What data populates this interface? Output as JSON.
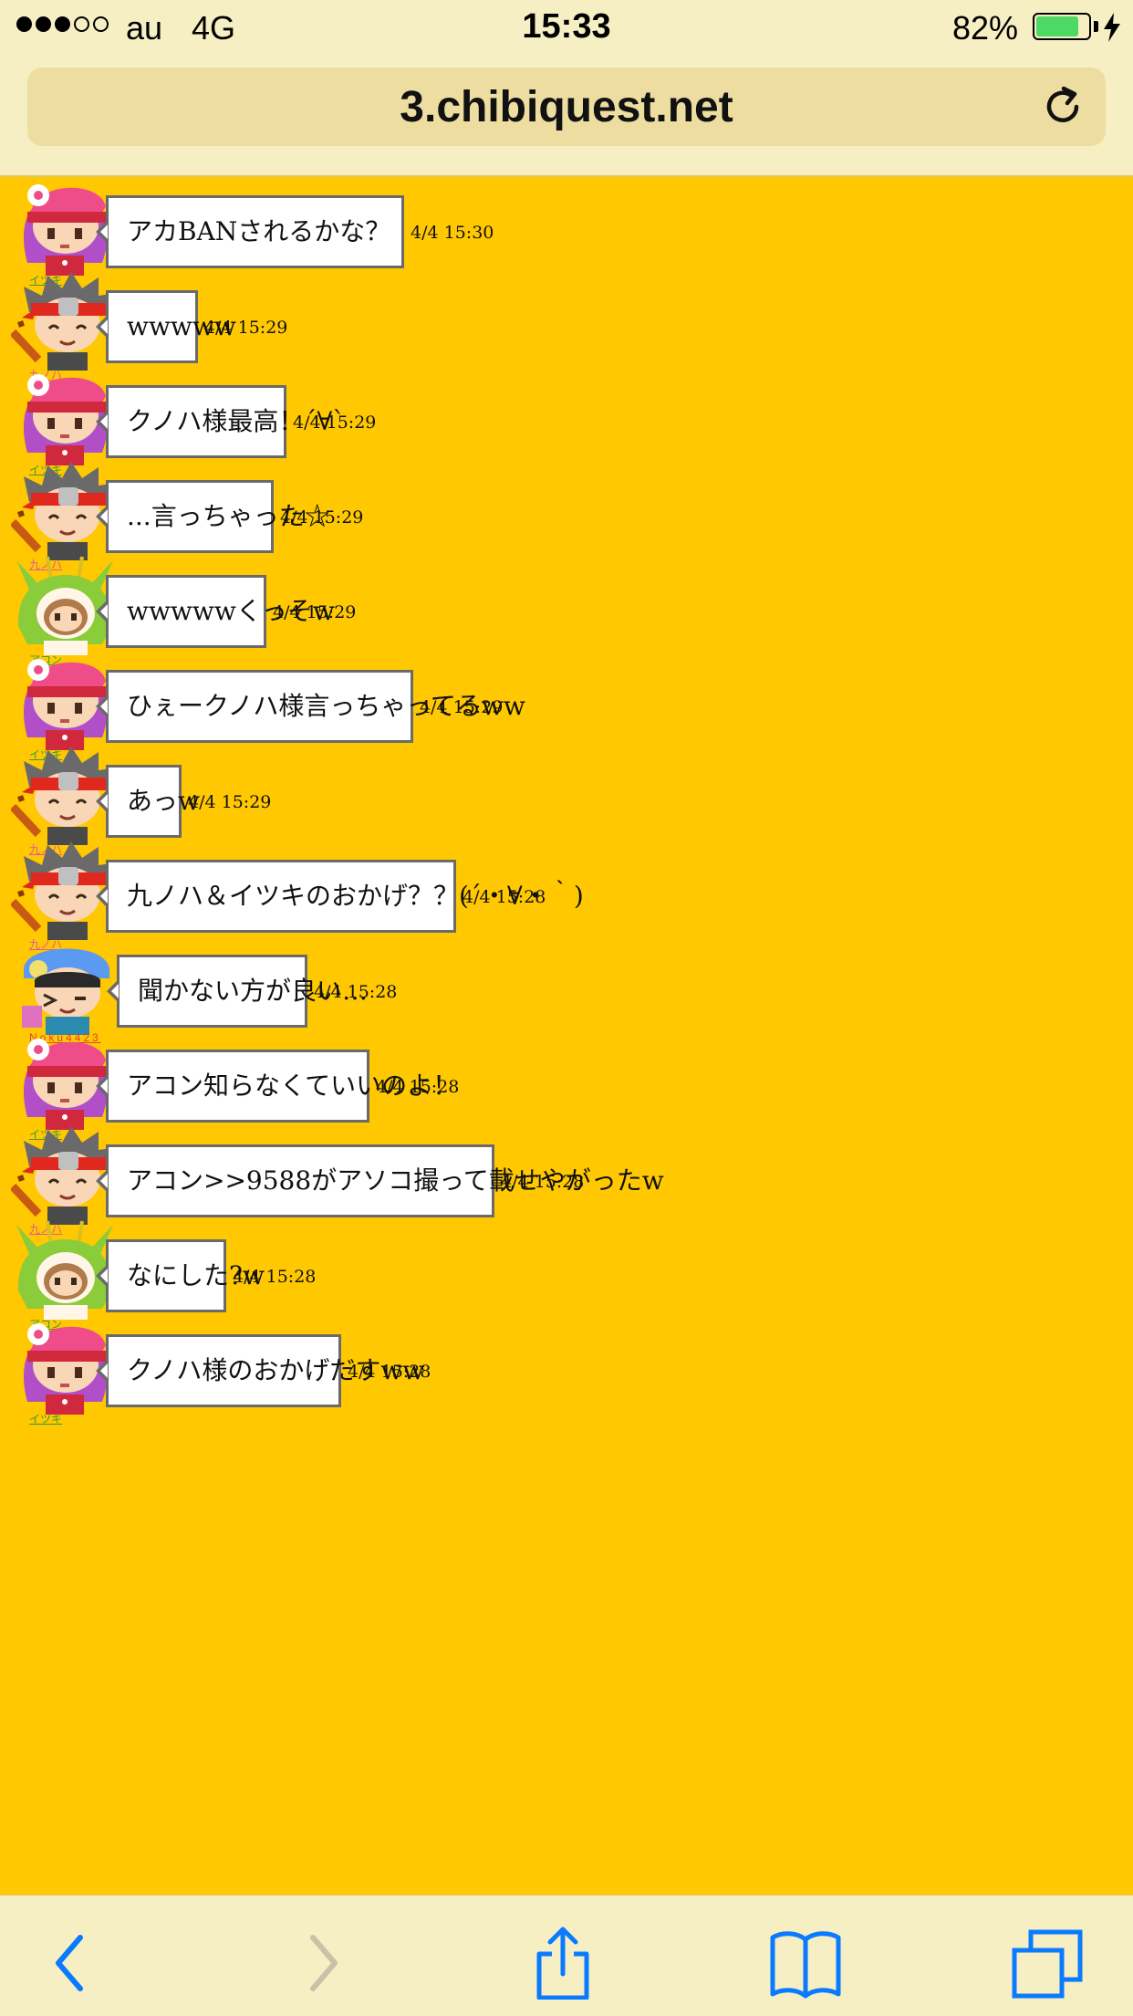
{
  "status_bar": {
    "carrier": "au",
    "network": "4G",
    "time": "15:33",
    "battery_percent": "82%",
    "signal_strength": 3,
    "battery_level": 0.82
  },
  "browser": {
    "url": "3.chibiquest.net"
  },
  "colors": {
    "page_background": "#FFC800",
    "browser_chrome": "#F7EFC4",
    "ios_blue": "#0A7AFF",
    "battery_green": "#4CD964"
  },
  "messages": [
    {
      "user": "イツキ",
      "avatar": "pink-hat-girl-avatar",
      "text": "アカBANされるかな？",
      "time": "4/4 15:30"
    },
    {
      "user": "九ノハ",
      "avatar": "red-headband-ninja-avatar",
      "text": "wwwww",
      "time": "4/4 15:29"
    },
    {
      "user": "イツキ",
      "avatar": "pink-hat-girl-avatar",
      "text": "クノハ様最高！´∀`",
      "time": "4/4 15:29"
    },
    {
      "user": "九ノハ",
      "avatar": "red-headband-ninja-avatar",
      "text": "...言っちゃった☆",
      "time": "4/4 15:29"
    },
    {
      "user": "アコン",
      "avatar": "green-dragon-hood-avatar",
      "text": "wwwwwくっそw",
      "time": "4/4 15:29"
    },
    {
      "user": "イツキ",
      "avatar": "pink-hat-girl-avatar",
      "text": "ひぇークノハ様言っちゃってるww",
      "time": "4/4 15:29"
    },
    {
      "user": "九ノハ",
      "avatar": "red-headband-ninja-avatar",
      "text": "あっw",
      "time": "4/4 15:29"
    },
    {
      "user": "九ノハ",
      "avatar": "red-headband-ninja-avatar",
      "text": "九ノハ＆イツキのおかげ？？(´・∀・｀)",
      "time": "4/4 15:28"
    },
    {
      "user": "Noku4423",
      "avatar": "blue-cap-boy-avatar",
      "text": "聞かない方が良い…",
      "time": "4/4 15:28"
    },
    {
      "user": "イツキ",
      "avatar": "pink-hat-girl-avatar",
      "text": "アコン知らなくていいのよ！",
      "time": "4/4 15:28"
    },
    {
      "user": "九ノハ",
      "avatar": "red-headband-ninja-avatar",
      "text": "アコン>>9588がアソコ撮って載せやがったw",
      "time": "4/4 15:28"
    },
    {
      "user": "アコン",
      "avatar": "green-dragon-hood-avatar",
      "text": "なにした?w",
      "time": "4/4 15:28"
    },
    {
      "user": "イツキ",
      "avatar": "pink-hat-girl-avatar",
      "text": "クノハ様のおかげだすww",
      "time": "4/4 15:28"
    }
  ],
  "toolbar": {
    "back": "back-chevron-icon",
    "forward": "forward-chevron-icon",
    "share": "share-icon",
    "bookmarks": "bookmarks-book-icon",
    "tabs": "tabs-icon"
  }
}
